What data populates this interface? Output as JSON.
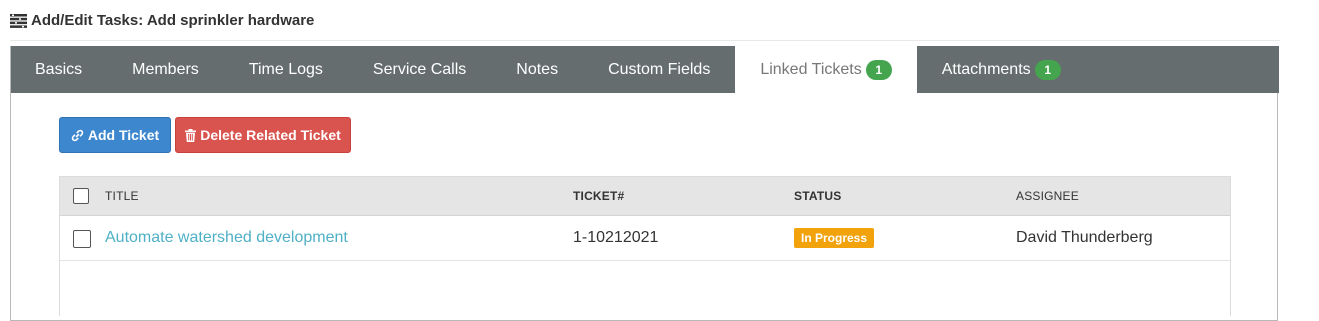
{
  "header": {
    "title": "Add/Edit Tasks: Add sprinkler hardware",
    "icon": "tasks-list-icon"
  },
  "tabs": [
    {
      "label": "Basics"
    },
    {
      "label": "Members"
    },
    {
      "label": "Time Logs"
    },
    {
      "label": "Service Calls"
    },
    {
      "label": "Notes"
    },
    {
      "label": "Custom Fields"
    },
    {
      "label": "Linked Tickets",
      "badge": "1",
      "active": true
    },
    {
      "label": "Attachments",
      "badge": "1"
    }
  ],
  "toolbar": {
    "add_ticket_label": "Add Ticket",
    "add_ticket_icon": "link-icon",
    "delete_label": "Delete Related Ticket",
    "delete_icon": "trash-icon"
  },
  "table": {
    "columns": [
      "TITLE",
      "TICKET#",
      "STATUS",
      "ASSIGNEE"
    ],
    "rows": [
      {
        "title": "Automate watershed development",
        "ticket": "1-10212021",
        "status": "In Progress",
        "assignee": "David Thunderberg"
      }
    ]
  },
  "colors": {
    "tab_bar": "#656d6f",
    "primary": "#3c87cd",
    "danger": "#d9534f",
    "badge": "#45a54f",
    "status_in_progress": "#f2a20a",
    "link": "#4fb0c6"
  }
}
